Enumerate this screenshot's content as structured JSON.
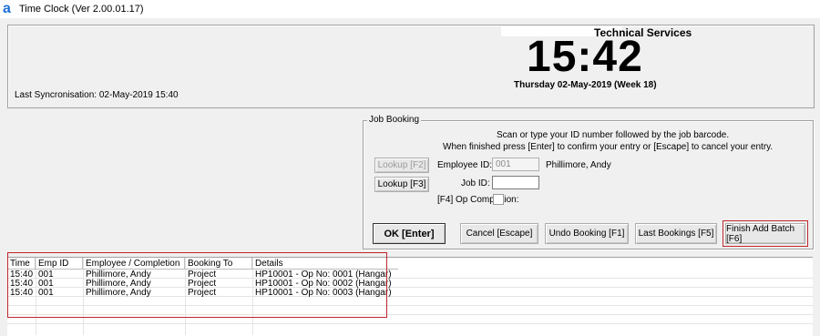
{
  "window": {
    "title": "Time Clock (Ver 2.00.01.17)"
  },
  "header": {
    "last_sync_label": "Last Syncronisation:",
    "last_sync_value": "02-May-2019 15:40",
    "department": "Technical Services",
    "time": "15:42",
    "date": "Thursday 02-May-2019 (Week 18)"
  },
  "job_booking": {
    "legend": "Job Booking",
    "instruction_line1": "Scan or type your ID number followed by the job barcode.",
    "instruction_line2": "When finished press [Enter] to confirm your entry or [Escape] to cancel your entry.",
    "lookup_f2": "Lookup [F2]",
    "lookup_f3": "Lookup [F3]",
    "employee_id_label": "Employee ID:",
    "employee_id_value": "001",
    "employee_name": "Phillimore, Andy",
    "job_id_label": "Job ID:",
    "job_id_value": "",
    "op_completion_label": "[F4]  Op Completion:",
    "op_completion_checked": false
  },
  "actions": {
    "ok": "OK [Enter]",
    "cancel": "Cancel [Escape]",
    "undo": "Undo Booking [F1]",
    "last": "Last Bookings [F5]",
    "finish": "Finish Add Batch [F6]"
  },
  "grid": {
    "columns": [
      "Time",
      "Emp ID",
      "Employee / Completion",
      "Booking To",
      "Details"
    ],
    "rows": [
      [
        "15:40",
        "001",
        "Phillimore, Andy",
        "Project",
        "HP10001 - Op No: 0001 (Hangar)"
      ],
      [
        "15:40",
        "001",
        "Phillimore, Andy",
        "Project",
        "HP10001 - Op No: 0002 (Hangar)"
      ],
      [
        "15:40",
        "001",
        "Phillimore, Andy",
        "Project",
        "HP10001 - Op No: 0003 (Hangar)"
      ]
    ]
  },
  "colors": {
    "highlight": "#c0262c",
    "window_bg": "#f0f0f0",
    "icon_accent": "#1e6fd9"
  },
  "icons": {
    "app": "app-logo-icon"
  }
}
